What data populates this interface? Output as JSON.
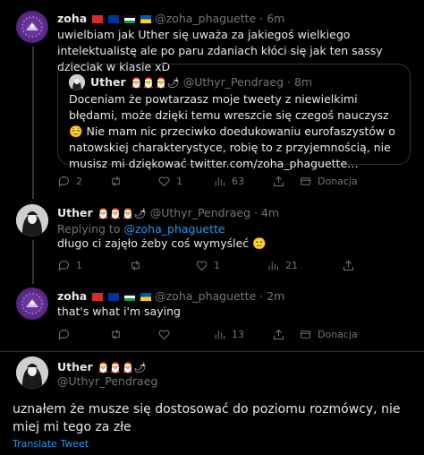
{
  "tweet1": {
    "name": "zoha",
    "handle": "@zoha_phaguette",
    "time": "6m",
    "text": "uwielbiam jak Uther się uważa za jakiegoś wielkiego intelektualistę ale po paru zdaniach kłóci się jak ten sassy dzieciak w klasie xD",
    "quote": {
      "name": "Uther",
      "name_glyphs": "🎅🎅🎅🌶",
      "handle": "@Uthyr_Pendraeg",
      "time": "8m",
      "text": "Doceniam że powtarzasz moje tweety z niewielkimi błędami, może dzięki temu wreszcie się czegoś nauczysz ☺️ Nie mam nic przeciwko doedukowaniu eurofaszystów o natowskiej charakterystyce, robię to z przyjemnością, nie musisz mi dziękować twitter.com/zoha_phaguette…"
    },
    "replies": "2",
    "retweets": "",
    "likes": "1",
    "views": "63",
    "donate": "Donacja"
  },
  "tweet2": {
    "name": "Uther",
    "name_glyphs": "🎅🎅🎅🌶",
    "handle": "@Uthyr_Pendraeg",
    "time": "4m",
    "replying_label": "Replying to",
    "replying_to": "@zoha_phaguette",
    "text": "długo ci zajęło żeby coś wymyśleć 🙂",
    "replies": "1",
    "retweets": "",
    "likes": "1",
    "views": "21"
  },
  "tweet3": {
    "name": "zoha",
    "handle": "@zoha_phaguette",
    "time": "2m",
    "text": "that's what i'm saying",
    "replies": "",
    "retweets": "",
    "likes": "",
    "views": "13",
    "donate": "Donacja"
  },
  "tweet4": {
    "name": "Uther",
    "name_glyphs": "🎅🎅🎅🌶",
    "handle": "@Uthyr_Pendraeg",
    "text": "uznałem że musze się dostosować do poziomu rozmówcy, nie miej mi tego za złe",
    "translate": "Translate Tweet"
  },
  "colors": {
    "background": "#000000",
    "text": "#e7e9ea",
    "muted": "#71767b",
    "accent": "#1d9bf0",
    "border": "#2f3336"
  }
}
